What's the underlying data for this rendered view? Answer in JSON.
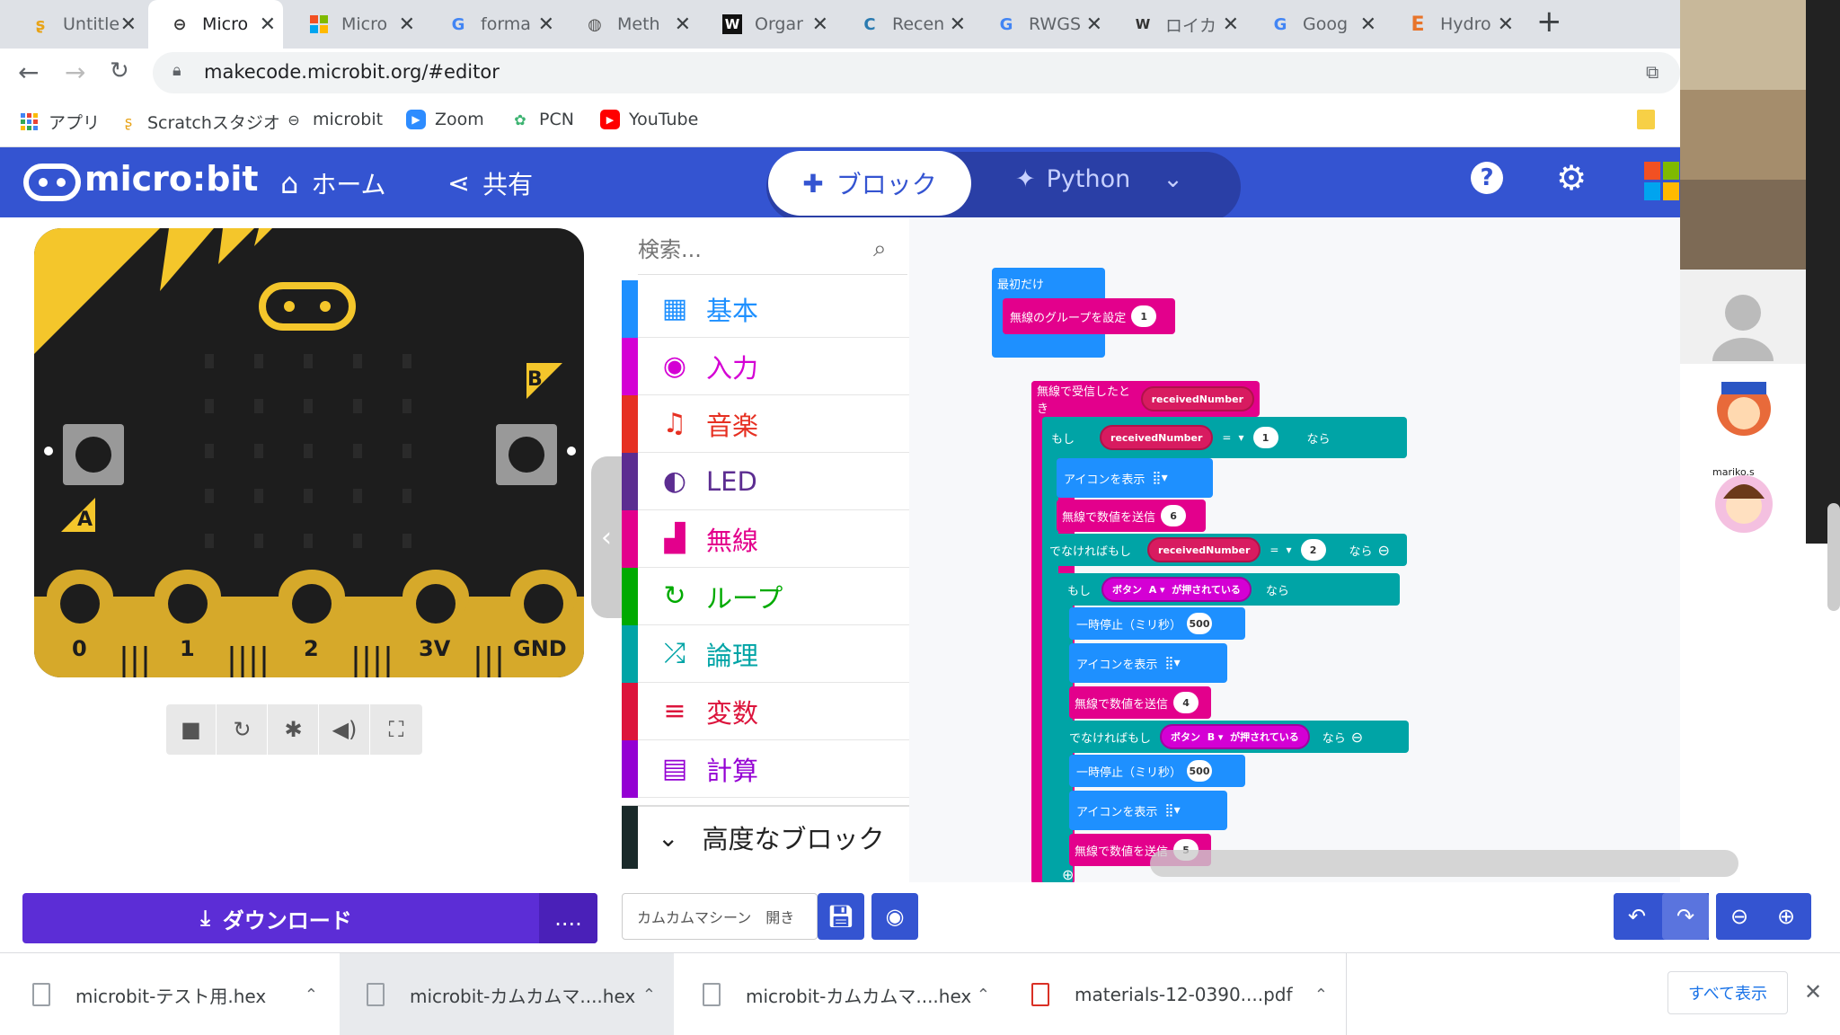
{
  "browser": {
    "tabs": [
      {
        "title": "Untitle",
        "icon": "scratch-icon"
      },
      {
        "title": "Micro",
        "icon": "microbit-icon"
      },
      {
        "title": "Micro",
        "icon": "microsoft-icon"
      },
      {
        "title": "forma",
        "icon": "google-icon"
      },
      {
        "title": "Meth",
        "icon": "globe-icon"
      },
      {
        "title": "Orgar",
        "icon": "wikipedia-icon"
      },
      {
        "title": "Recen",
        "icon": "c-icon"
      },
      {
        "title": "RWGS",
        "icon": "google-icon"
      },
      {
        "title": "ロイカ",
        "icon": "wikipedia-icon"
      },
      {
        "title": "Goog",
        "icon": "translate-icon"
      },
      {
        "title": "Hydro",
        "icon": "e-icon"
      }
    ],
    "url": "makecode.microbit.org/#editor",
    "bookmarks": [
      {
        "label": "アプリ",
        "icon": "apps-grid-icon"
      },
      {
        "label": "Scratchスタジオ",
        "icon": "scratch-icon"
      },
      {
        "label": "microbit",
        "icon": "microbit-icon"
      },
      {
        "label": "Zoom",
        "icon": "zoom-icon"
      },
      {
        "label": "PCN",
        "icon": "pcn-icon"
      },
      {
        "label": "YouTube",
        "icon": "youtube-icon"
      }
    ]
  },
  "header": {
    "logo": "micro:bit",
    "home": "ホーム",
    "share": "共有",
    "blocks": "ブロック",
    "python": "Python"
  },
  "simulator": {
    "pins": [
      "0",
      "1",
      "2",
      "3V",
      "GND"
    ],
    "button_a": "A",
    "button_b": "B"
  },
  "toolbox": {
    "search_placeholder": "検索...",
    "categories": [
      {
        "label": "基本",
        "color": "#1e90ff",
        "icon": "grid-icon"
      },
      {
        "label": "入力",
        "color": "#d400d4",
        "icon": "target-icon"
      },
      {
        "label": "音楽",
        "color": "#e63022",
        "icon": "headphones-icon"
      },
      {
        "label": "LED",
        "color": "#5c2d91",
        "icon": "toggle-icon"
      },
      {
        "label": "無線",
        "color": "#e3008c",
        "icon": "signal-icon"
      },
      {
        "label": "ループ",
        "color": "#00aa00",
        "icon": "loop-icon"
      },
      {
        "label": "論理",
        "color": "#00a4a6",
        "icon": "shuffle-icon"
      },
      {
        "label": "変数",
        "color": "#dc143c",
        "icon": "list-icon"
      },
      {
        "label": "計算",
        "color": "#9400d3",
        "icon": "calculator-icon"
      }
    ],
    "advanced": "高度なブロック"
  },
  "workspace": {
    "on_start": "最初だけ",
    "set_group": "無線のグループを設定",
    "set_group_val": "1",
    "on_received": "無線で受信したとき",
    "received_var": "receivedNumber",
    "if_label": "もし",
    "then_label": "なら",
    "eq": "=",
    "if_val": "1",
    "show_icon": "アイコンを表示",
    "send_number": "無線で数値を送信",
    "send_val_1": "6",
    "else_if": "でなければもし",
    "elseif_val": "2",
    "button_word": "ボタン",
    "button_a": "A",
    "button_b": "B",
    "pressed": "が押されている",
    "pause": "一時停止（ミリ秒）",
    "pause_val": "500",
    "send_val_2": "4",
    "send_val_3": "5"
  },
  "bottom": {
    "download": "ダウンロード",
    "more": "....",
    "project_name": "カムカムマシーン　開き"
  },
  "shelf": {
    "items": [
      "microbit-テスト用.hex",
      "microbit-カムカムマ....hex",
      "microbit-カムカムマ....hex",
      "materials-12-0390....pdf"
    ],
    "show_all": "すべて表示"
  },
  "video": {
    "participant_label": "mariko.s"
  }
}
